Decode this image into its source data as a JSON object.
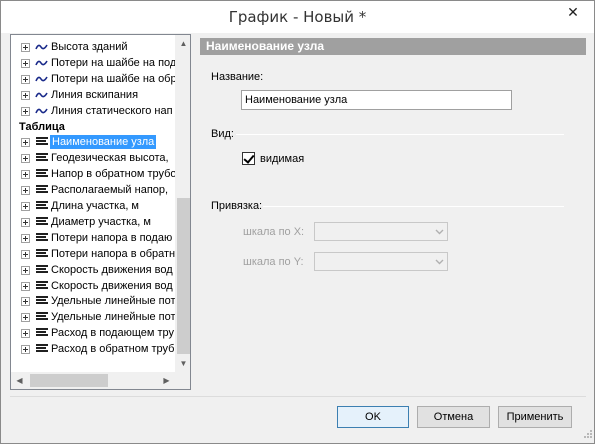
{
  "window": {
    "title": "График - Новый *",
    "close_glyph": "✕"
  },
  "tree": {
    "items": [
      {
        "type": "wave",
        "label": "Высота зданий"
      },
      {
        "type": "wave",
        "label": "Потери на шайбе на под"
      },
      {
        "type": "wave",
        "label": "Потери на шайбе на обр"
      },
      {
        "type": "wave",
        "label": "Линия вскипания"
      },
      {
        "type": "wave",
        "label": "Линия статического нап"
      },
      {
        "type": "group",
        "label": "Таблица"
      },
      {
        "type": "table",
        "label": "Наименование узла",
        "selected": true
      },
      {
        "type": "table",
        "label": "Геодезическая высота,"
      },
      {
        "type": "table",
        "label": "Напор в обратном трубо"
      },
      {
        "type": "table",
        "label": "Располагаемый напор,"
      },
      {
        "type": "table",
        "label": "Длина участка, м"
      },
      {
        "type": "table",
        "label": "Диаметр участка, м"
      },
      {
        "type": "table",
        "label": "Потери напора в подаю"
      },
      {
        "type": "table",
        "label": "Потери напора в обратн"
      },
      {
        "type": "table",
        "label": "Скорость движения вод"
      },
      {
        "type": "table",
        "label": "Скорость движения вод"
      },
      {
        "type": "table",
        "label": "Удельные линейные пот"
      },
      {
        "type": "table",
        "label": "Удельные линейные пот"
      },
      {
        "type": "table",
        "label": "Расход в подающем тру"
      },
      {
        "type": "table",
        "label": "Расход в обратном труб"
      }
    ],
    "scroll_up": "▲",
    "scroll_down": "▼",
    "scroll_left": "◀",
    "scroll_right": "▶"
  },
  "panel": {
    "header": "Наименование узла",
    "name_label": "Название:",
    "name_value": "Наименование узла",
    "view_label": "Вид:",
    "visible_label": "видимая",
    "visible_checked": true,
    "binding_label": "Привязка:",
    "scale_x_label": "шкала по X:",
    "scale_y_label": "шкала по Y:"
  },
  "buttons": {
    "ok": "OK",
    "cancel": "Отмена",
    "apply": "Применить"
  },
  "colors": {
    "selection": "#3399ff",
    "header_bg": "#a0a0a0",
    "wave_icon": "#1a2a8a"
  }
}
